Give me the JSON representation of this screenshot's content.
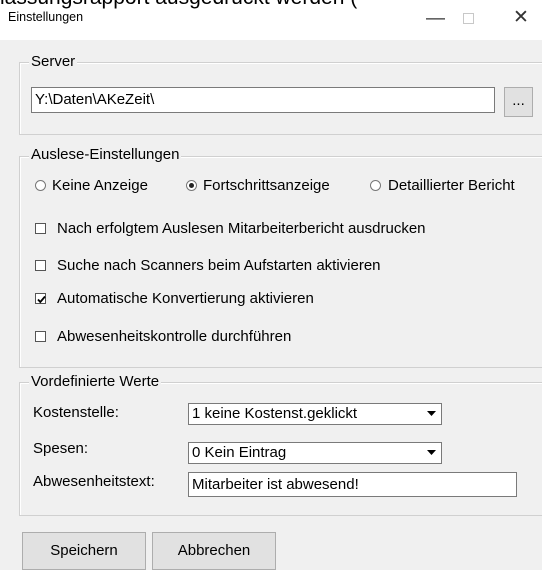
{
  "background_text": "iassungsrapport ausgedruckt werden (",
  "window": {
    "title": "Einstellungen",
    "minimize_glyph": "—",
    "close_glyph": "✕"
  },
  "server": {
    "legend": "Server",
    "path_value": "Y:\\Daten\\AKeZeit\\",
    "browse_label": "..."
  },
  "auslese": {
    "legend": "Auslese-Einstellungen",
    "radios": [
      {
        "label": "Keine Anzeige",
        "selected": false
      },
      {
        "label": "Fortschrittsanzeige",
        "selected": true
      },
      {
        "label": "Detaillierter Bericht",
        "selected": false
      }
    ],
    "checkboxes": [
      {
        "label": "Nach erfolgtem Auslesen Mitarbeiterbericht ausdrucken",
        "checked": false
      },
      {
        "label": "Suche nach Scanners beim Aufstarten aktivieren",
        "checked": false
      },
      {
        "label": "Automatische Konvertierung aktivieren",
        "checked": true
      },
      {
        "label": "Abwesenheitskontrolle durchführen",
        "checked": false
      }
    ]
  },
  "vordefiniert": {
    "legend": "Vordefinierte Werte",
    "kostenstelle_label": "Kostenstelle:",
    "kostenstelle_value": "1 keine Kostenst.geklickt",
    "spesen_label": "Spesen:",
    "spesen_value": "0 Kein Eintrag",
    "abwesenheit_label": "Abwesenheitstext:",
    "abwesenheit_value": "Mitarbeiter ist abwesend!"
  },
  "buttons": {
    "save": "Speichern",
    "cancel": "Abbrechen"
  }
}
